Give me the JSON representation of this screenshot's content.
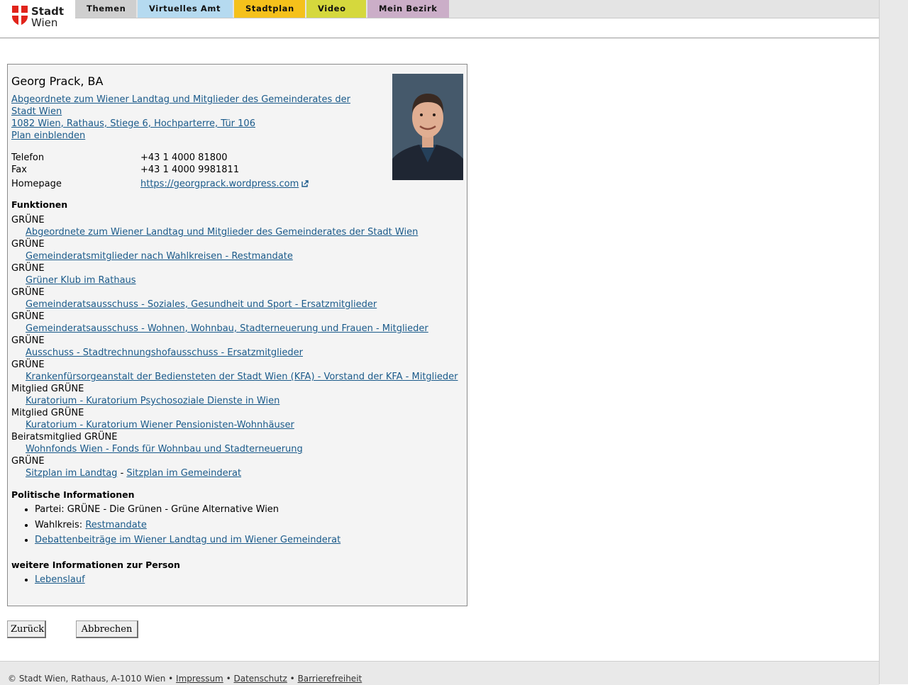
{
  "brand": {
    "line1": "Stadt",
    "line2": "Wien"
  },
  "nav": {
    "tabs": [
      {
        "label": "Themen"
      },
      {
        "label": "Virtuelles Amt"
      },
      {
        "label": "Stadtplan"
      },
      {
        "label": "Video"
      },
      {
        "label": "Mein Bezirk"
      }
    ]
  },
  "person": {
    "name": "Georg Prack, BA",
    "role_link": "Abgeordnete zum Wiener Landtag und Mitglieder des Gemeinderates der Stadt Wien",
    "address_link": "1082 Wien, Rathaus, Stiege 6, Hochparterre, Tür 106",
    "plan_link": "Plan einblenden",
    "contact": [
      {
        "label": "Telefon",
        "value": "+43 1 4000 81800"
      },
      {
        "label": "Fax",
        "value": "+43 1 4000 9981811"
      },
      {
        "label": "Homepage",
        "value": "https://georgprack.wordpress.com"
      }
    ]
  },
  "functions": {
    "heading": "Funktionen",
    "items": [
      {
        "role": "GRÜNE",
        "link": "Abgeordnete zum Wiener Landtag und Mitglieder des Gemeinderates der Stadt Wien"
      },
      {
        "role": "GRÜNE",
        "link": "Gemeinderatsmitglieder nach Wahlkreisen - Restmandate"
      },
      {
        "role": "GRÜNE",
        "link": "Grüner Klub im Rathaus"
      },
      {
        "role": "GRÜNE",
        "link": "Gemeinderatsausschuss - Soziales, Gesundheit und Sport - Ersatzmitglieder"
      },
      {
        "role": "GRÜNE",
        "link": "Gemeinderatsausschuss - Wohnen, Wohnbau, Stadterneuerung und Frauen - Mitglieder"
      },
      {
        "role": "GRÜNE",
        "link": "Ausschuss - Stadtrechnungshofausschuss - Ersatzmitglieder"
      },
      {
        "role": "GRÜNE",
        "link": "Krankenfürsorgeanstalt der Bediensteten der Stadt Wien (KFA) - Vorstand der KFA - Mitglieder"
      },
      {
        "role": "Mitglied GRÜNE",
        "link": "Kuratorium - Kuratorium Psychosoziale Dienste in Wien"
      },
      {
        "role": "Mitglied GRÜNE",
        "link": "Kuratorium - Kuratorium Wiener Pensionisten-Wohnhäuser"
      },
      {
        "role": "Beiratsmitglied GRÜNE",
        "link": "Wohnfonds Wien - Fonds für Wohnbau und Stadterneuerung"
      }
    ],
    "last_role": "GRÜNE",
    "seating_landtag": "Sitzplan im Landtag",
    "seating_separator": "-",
    "seating_gemeinderat": "Sitzplan im Gemeinderat"
  },
  "political": {
    "heading": "Politische Informationen",
    "party": "Partei: GRÜNE - Die Grünen - Grüne Alternative Wien",
    "district_label": "Wahlkreis:",
    "district_link": "Restmandate",
    "debates_link": "Debattenbeiträge im Wiener Landtag und im Wiener Gemeinderat"
  },
  "further": {
    "heading": "weitere Informationen zur Person",
    "cv_link": "Lebenslauf"
  },
  "buttons": {
    "back": "Zurück",
    "cancel": "Abbrechen"
  },
  "footer": {
    "copyright": "© Stadt Wien, Rathaus, A-1010 Wien",
    "sep": "•",
    "impressum": "Impressum",
    "datenschutz": "Datenschutz",
    "barrierefreiheit": "Barrierefreiheit"
  },
  "colors": {
    "tab_themen": "#cfcfcf",
    "tab_virtuelles_amt": "#b5daf0",
    "tab_stadtplan": "#f5c11b",
    "tab_video": "#d5d83d",
    "tab_mein_bezirk": "#cbaec8",
    "link": "#1a5a8a",
    "logo_red": "#e1241b"
  }
}
